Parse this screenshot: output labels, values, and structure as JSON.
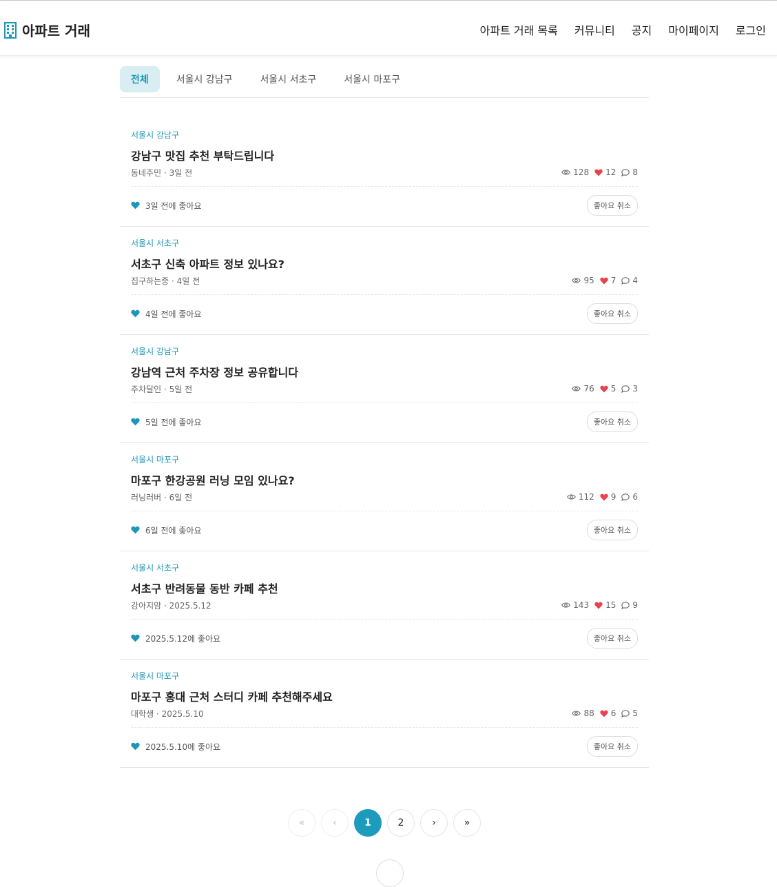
{
  "header": {
    "title": "아파트 거래",
    "nav": [
      "아파트 거래 목록",
      "커뮤니티",
      "공지",
      "마이페이지",
      "로그인"
    ]
  },
  "tabs": [
    "전체",
    "서울시 강남구",
    "서울시 서초구",
    "서울시 마포구"
  ],
  "active_tab": "전체",
  "unlike_label": "좋아요 취소",
  "posts": [
    {
      "region": "서울시 강남구",
      "title": "강남구 맛집 추천 부탁드립니다",
      "meta": "동네주민 · 3일 전",
      "views": "128",
      "likes": "12",
      "comments": "8",
      "liked": "3일 전에 좋아요"
    },
    {
      "region": "서울시 서초구",
      "title": "서초구 신축 아파트 정보 있나요?",
      "meta": "집구하는중 · 4일 전",
      "views": "95",
      "likes": "7",
      "comments": "4",
      "liked": "4일 전에 좋아요"
    },
    {
      "region": "서울시 강남구",
      "title": "강남역 근처 주차장 정보 공유합니다",
      "meta": "주차달인 · 5일 전",
      "views": "76",
      "likes": "5",
      "comments": "3",
      "liked": "5일 전에 좋아요"
    },
    {
      "region": "서울시 마포구",
      "title": "마포구 한강공원 러닝 모임 있나요?",
      "meta": "러닝러버 · 6일 전",
      "views": "112",
      "likes": "9",
      "comments": "6",
      "liked": "6일 전에 좋아요"
    },
    {
      "region": "서울시 서초구",
      "title": "서초구 반려동물 동반 카페 추천",
      "meta": "강아지맘 · 2025.5.12",
      "views": "143",
      "likes": "15",
      "comments": "9",
      "liked": "2025.5.12에 좋아요"
    },
    {
      "region": "서울시 마포구",
      "title": "마포구 홍대 근처 스터디 카페 추천해주세요",
      "meta": "대학생 · 2025.5.10",
      "views": "88",
      "likes": "6",
      "comments": "5",
      "liked": "2025.5.10에 좋아요"
    }
  ],
  "pagination": {
    "first": "«",
    "prev": "‹",
    "pages": [
      "1",
      "2"
    ],
    "current": "1",
    "next": "›",
    "last": "»"
  },
  "colors": {
    "accent": "#1d9bbd",
    "heart": "#e8424e",
    "liked_heart": "#1d97b8"
  }
}
